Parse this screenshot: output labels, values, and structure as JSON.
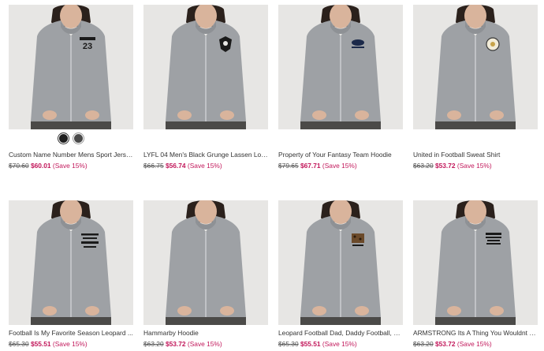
{
  "colors": {
    "sale": "#c2185b",
    "hoodie": "#9ea1a5",
    "background": "#e7e6e4"
  },
  "products": [
    {
      "title": "Custom Name Number Mens Sport Jerse...",
      "old_price": "$70.60",
      "new_price": "$60.01",
      "save": "(Save 15%)",
      "print_text": "23",
      "swatches": [
        {
          "color": "#1f1f1f",
          "selected": true
        },
        {
          "color": "#4a4a4a",
          "selected": false
        }
      ]
    },
    {
      "title": "LYFL 04 Men's Black Grunge Lassen Log...",
      "old_price": "$66.75",
      "new_price": "$56.74",
      "save": "(Save 15%)"
    },
    {
      "title": "Property of Your Fantasy Team Hoodie",
      "old_price": "$79.65",
      "new_price": "$67.71",
      "save": "(Save 15%)"
    },
    {
      "title": "United in Football Sweat Shirt",
      "old_price": "$63.20",
      "new_price": "$53.72",
      "save": "(Save 15%)"
    },
    {
      "title": "Football Is My Favorite Season Leopard ...",
      "old_price": "$65.30",
      "new_price": "$55.51",
      "save": "(Save 15%)"
    },
    {
      "title": "Hammarby Hoodie",
      "old_price": "$63.20",
      "new_price": "$53.72",
      "save": "(Save 15%)"
    },
    {
      "title": "Leopard Football Dad, Daddy Football, S...",
      "old_price": "$65.30",
      "new_price": "$55.51",
      "save": "(Save 15%)"
    },
    {
      "title": "ARMSTRONG Its A Thing You Wouldnt U...",
      "old_price": "$63.20",
      "new_price": "$53.72",
      "save": "(Save 15%)"
    }
  ]
}
